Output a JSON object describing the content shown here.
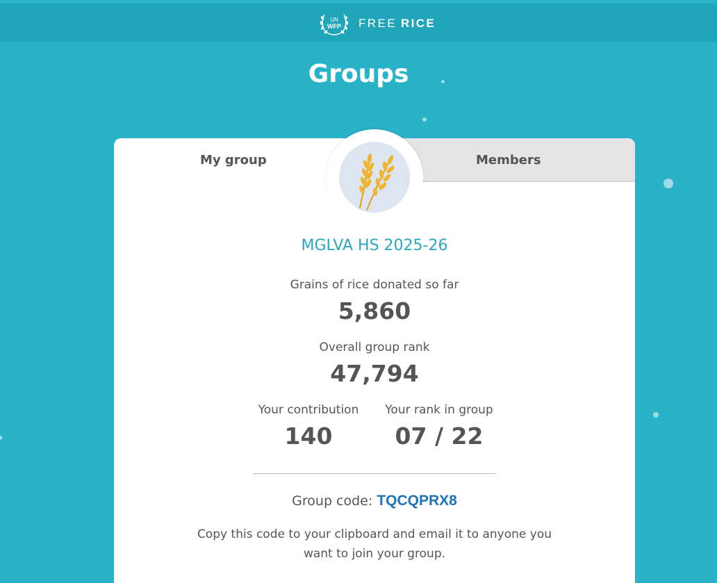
{
  "header": {
    "logo_un": "UN",
    "logo_wfp": "WFP",
    "brand_free": "FREE",
    "brand_rice": "RICE",
    "colors": {
      "bar": "#1fa6ba",
      "background": "#2ab3c8"
    }
  },
  "page": {
    "title": "Groups"
  },
  "tabs": [
    {
      "label": "My group",
      "active": true
    },
    {
      "label": "Members",
      "active": false
    }
  ],
  "group": {
    "emblem_icon": "wheat-icon",
    "name": "MGLVA HS 2025-26",
    "grains_label": "Grains of rice donated so far",
    "grains_value": "5,860",
    "rank_label": "Overall group rank",
    "rank_value": "47,794",
    "contribution_label": "Your contribution",
    "contribution_value": "140",
    "member_rank_label": "Your rank in group",
    "member_rank_value": "07 / 22",
    "code_label": "Group code:",
    "code_value": "TQCQPRX8",
    "help_text": "Copy this code to your clipboard and email it to anyone you want to join your group."
  },
  "colors": {
    "accent": "#2aa7bd",
    "code_link": "#1f73b7",
    "text": "#555555"
  }
}
